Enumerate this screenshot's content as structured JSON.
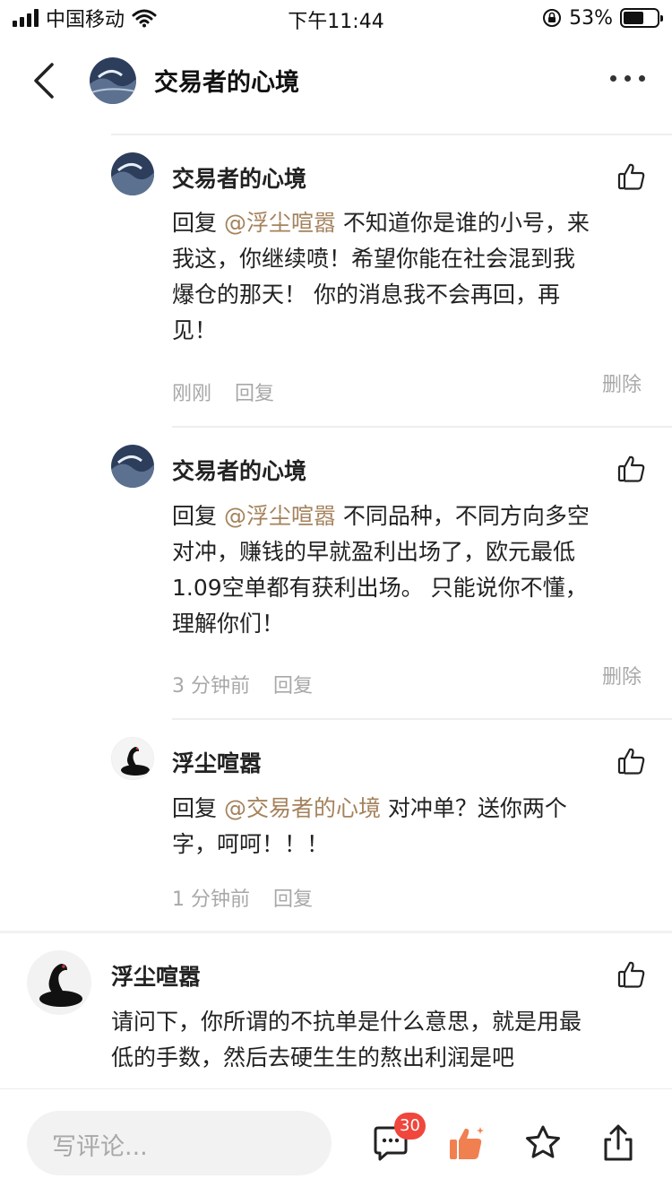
{
  "status_bar": {
    "carrier": "中国移动",
    "time": "下午11:44",
    "battery": "53%"
  },
  "header": {
    "title": "交易者的心境"
  },
  "comments": [
    {
      "author": "交易者的心境",
      "reply_prefix": "回复",
      "mention": "@浮尘喧嚣",
      "line1_rest": " 不知道你是谁的小号，来",
      "lines": [
        "我这，你继续喷！希望你能在社会混到我",
        "爆仓的那天！ 你的消息我不会再回，再",
        "见！"
      ],
      "time": "刚刚",
      "reply_label": "回复",
      "delete_label": "删除"
    },
    {
      "author": "交易者的心境",
      "reply_prefix": "回复",
      "mention": "@浮尘喧嚣",
      "line1_rest": " 不同品种，不同方向多空",
      "lines": [
        "对冲，赚钱的早就盈利出场了，欧元最低",
        "1.09空单都有获利出场。 只能说你不懂，",
        "理解你们！"
      ],
      "time": "3 分钟前",
      "reply_label": "回复",
      "delete_label": "删除"
    },
    {
      "author": "浮尘喧嚣",
      "reply_prefix": "回复",
      "mention": "@交易者的心境",
      "line1_rest": " 对冲单？送你两个",
      "lines": [
        "字，呵呵！！！"
      ],
      "time": "1 分钟前",
      "reply_label": "回复"
    },
    {
      "author": "浮尘喧嚣",
      "lines": [
        "请问下，你所谓的不抗单是什么意思，就是用最",
        "低的手数，然后去硬生生的熬出利润是吧"
      ]
    }
  ],
  "bottom_bar": {
    "input_placeholder": "写评论...",
    "comment_count": "30"
  },
  "colors": {
    "mention": "#a4825c",
    "badge": "#f0463c",
    "like_active": "#f08050"
  }
}
